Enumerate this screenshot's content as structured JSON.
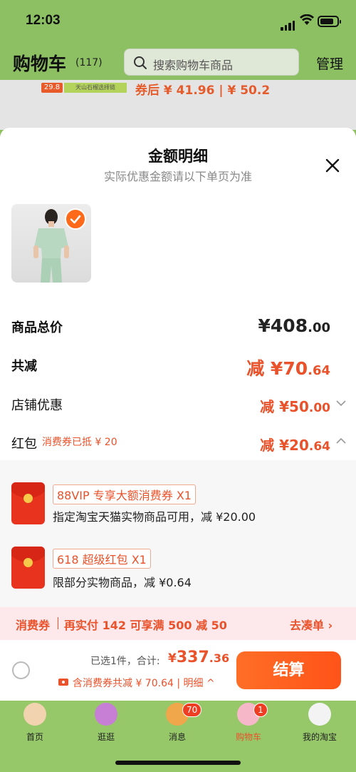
{
  "status": {
    "time": "12:03"
  },
  "header": {
    "title": "购物车",
    "count": "(117)",
    "search_placeholder": "搜索购物车商品",
    "manage_label": "管理"
  },
  "behind": {
    "badge_price": "29.8",
    "badge_label": "天山石榴选择链",
    "price_text": "券后 ¥ 41.96 | ¥ 50.2"
  },
  "sheet": {
    "title": "金额明细",
    "subtitle": "实际优惠金额请以下单页为准",
    "rows": {
      "total_label": "商品总价",
      "total_int": "¥408",
      "total_dec": ".00",
      "reduce_label": "共减",
      "reduce_int": "减 ¥70",
      "reduce_dec": ".64",
      "shop_label": "店铺优惠",
      "shop_int": "减 ¥50",
      "shop_dec": ".00",
      "redpack_label": "红包",
      "redpack_tag": "消费券已抵 ¥ 20",
      "redpack_int": "减 ¥20",
      "redpack_dec": ".64"
    },
    "packets": [
      {
        "tag": "88VIP 专享大额消费券 X1",
        "desc": "指定淘宝天猫实物商品可用，减 ¥20.00"
      },
      {
        "tag": "618 超级红包 X1",
        "desc": "限部分实物商品，减 ¥0.64"
      }
    ],
    "promo": {
      "left": "消费券",
      "middle": "再实付 142 可享满 500 减 50",
      "right": "去凑单 ›"
    },
    "bottom": {
      "selected": "已选1件，合计:",
      "currency": "¥",
      "amount_int": "337",
      "amount_dec": ".36",
      "sub": "含消费券共减 ¥ 70.64 | 明细 ^",
      "checkout": "结算"
    }
  },
  "tabs": [
    {
      "label": "首页"
    },
    {
      "label": "逛逛"
    },
    {
      "label": "消息",
      "badge": "70"
    },
    {
      "label": "购物车",
      "badge": "1"
    },
    {
      "label": "我的淘宝"
    }
  ],
  "colors": {
    "accent": "#e9522a",
    "header_bg": "#8cc062",
    "checkout": "#ff5f1f"
  }
}
